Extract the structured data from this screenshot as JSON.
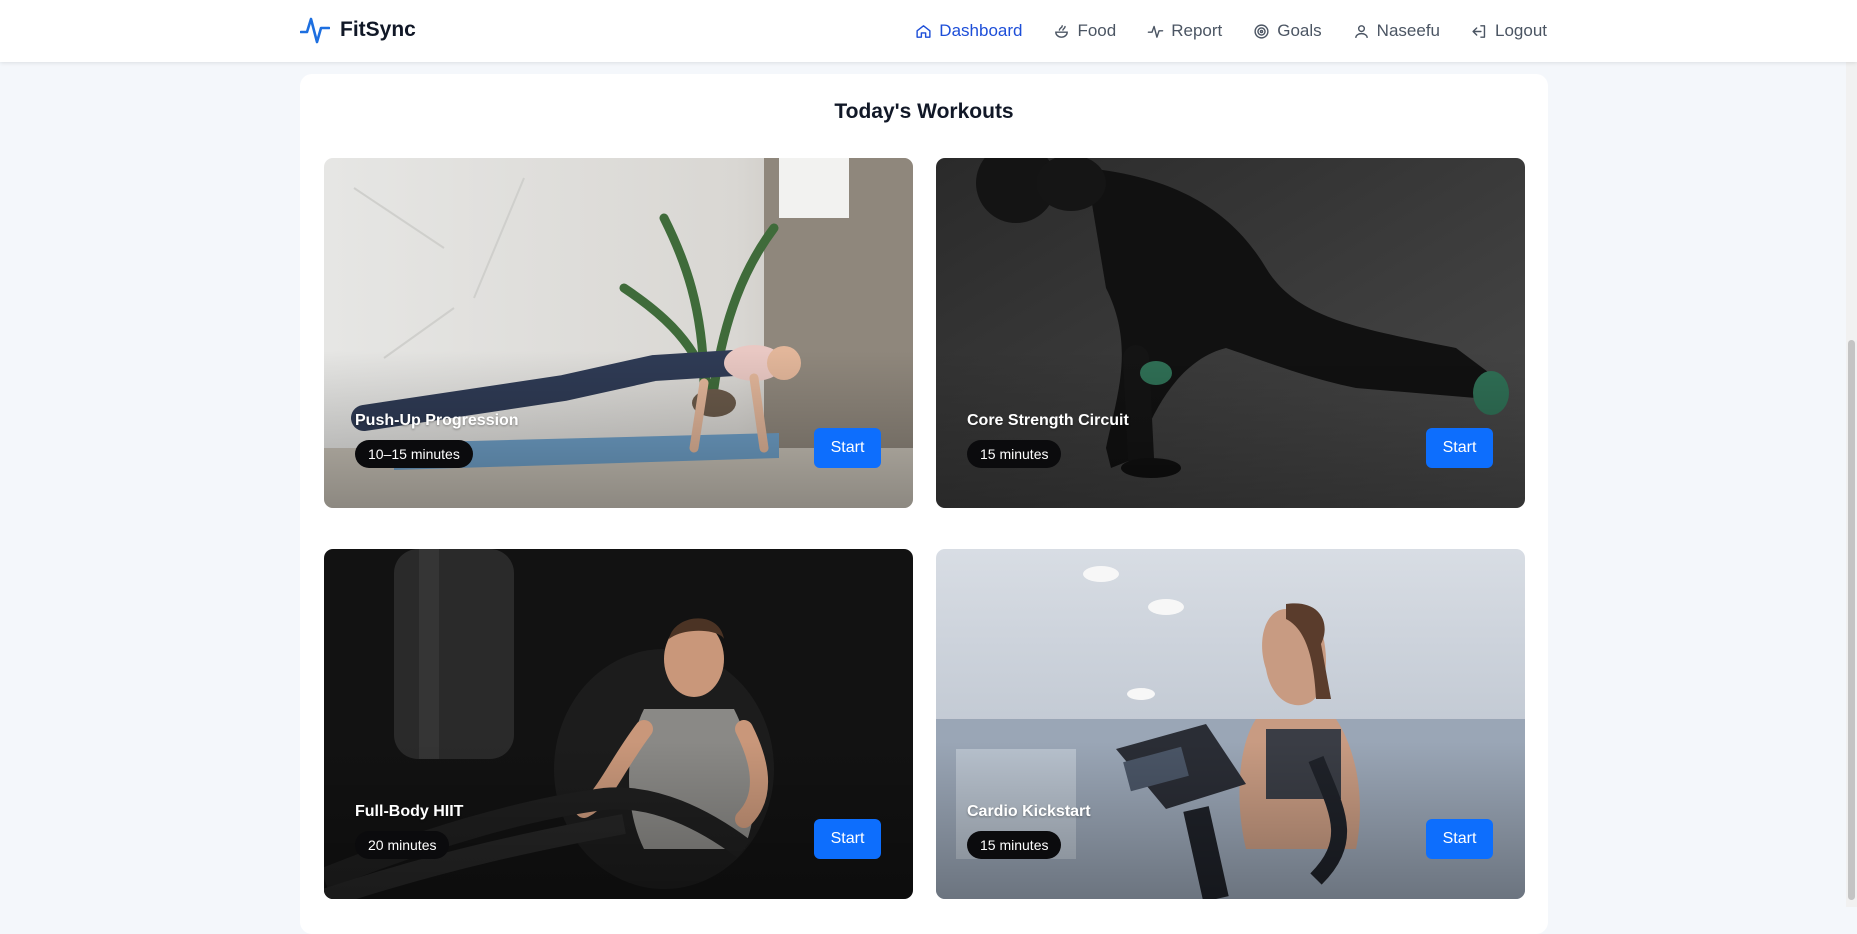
{
  "brand": {
    "name": "FitSync",
    "accent": "#1d6fe0"
  },
  "nav": {
    "items": [
      {
        "label": "Dashboard",
        "icon": "home-icon",
        "active": true
      },
      {
        "label": "Food",
        "icon": "food-icon"
      },
      {
        "label": "Report",
        "icon": "activity-icon"
      },
      {
        "label": "Goals",
        "icon": "target-icon"
      },
      {
        "label": "Naseefu",
        "icon": "user-icon"
      },
      {
        "label": "Logout",
        "icon": "logout-icon"
      }
    ],
    "active_color": "#1d4ed8"
  },
  "workouts": {
    "title": "Today's Workouts",
    "start_label": "Start",
    "button_color": "#0d6efd",
    "cards": [
      {
        "title": "Push-Up Progression",
        "duration": "10–15 minutes"
      },
      {
        "title": "Core Strength Circuit",
        "duration": "15 minutes"
      },
      {
        "title": "Full-Body HIIT",
        "duration": "20 minutes"
      },
      {
        "title": "Cardio Kickstart",
        "duration": "15 minutes"
      }
    ]
  }
}
